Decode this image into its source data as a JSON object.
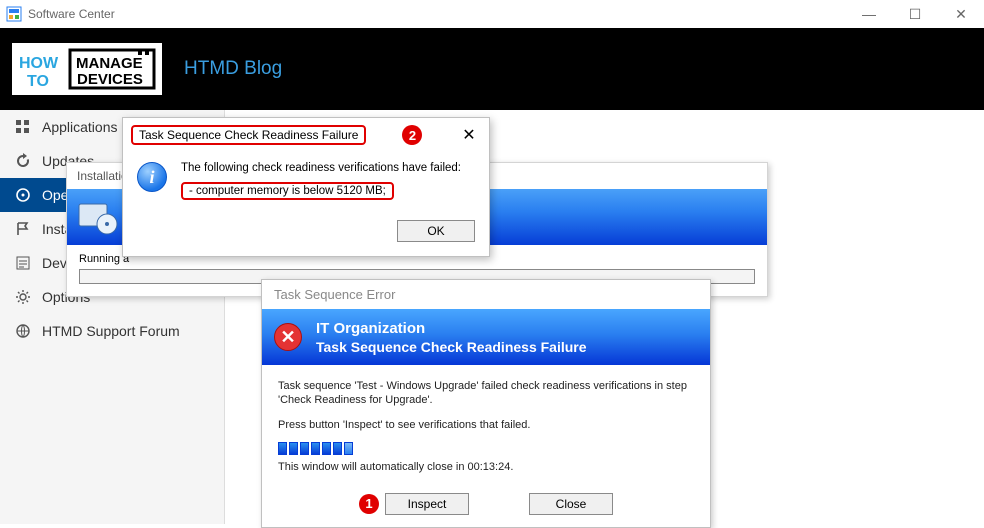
{
  "window": {
    "title": "Software Center"
  },
  "brand": {
    "title": "HTMD Blog",
    "logo_how": "HOW",
    "logo_to": "TO",
    "logo_manage": "MANAGE",
    "logo_devices": "DEVICES"
  },
  "sidebar": {
    "items": [
      {
        "label": "Applications"
      },
      {
        "label": "Updates"
      },
      {
        "label": "Operating Systems"
      },
      {
        "label": "Installation status"
      },
      {
        "label": "Device compliance"
      },
      {
        "label": "Options"
      },
      {
        "label": "HTMD Support Forum"
      }
    ],
    "active_index": 2
  },
  "install_progress": {
    "title": "Installation Progress",
    "running_label": "Running a"
  },
  "task_sequence_error": {
    "title": "Task Sequence Error",
    "org": "IT Organization",
    "headline": "Task Sequence Check Readiness Failure",
    "body_line1": "Task sequence 'Test - Windows Upgrade' failed check readiness verifications in step 'Check Readiness for Upgrade'.",
    "body_line2": "Press button 'Inspect' to see verifications that failed.",
    "countdown": "This window will automatically close in 00:13:24.",
    "inspect_label": "Inspect",
    "close_label": "Close",
    "callout1": "1"
  },
  "check_readiness_dialog": {
    "title": "Task Sequence Check Readiness Failure",
    "callout2": "2",
    "message": "The following check readiness verifications have failed:",
    "reason": "- computer memory is below 5120 MB;",
    "ok_label": "OK"
  },
  "glyphs": {
    "close": "✕",
    "minimize": "—",
    "maximize": "☐",
    "info": "i",
    "error": "✕"
  }
}
